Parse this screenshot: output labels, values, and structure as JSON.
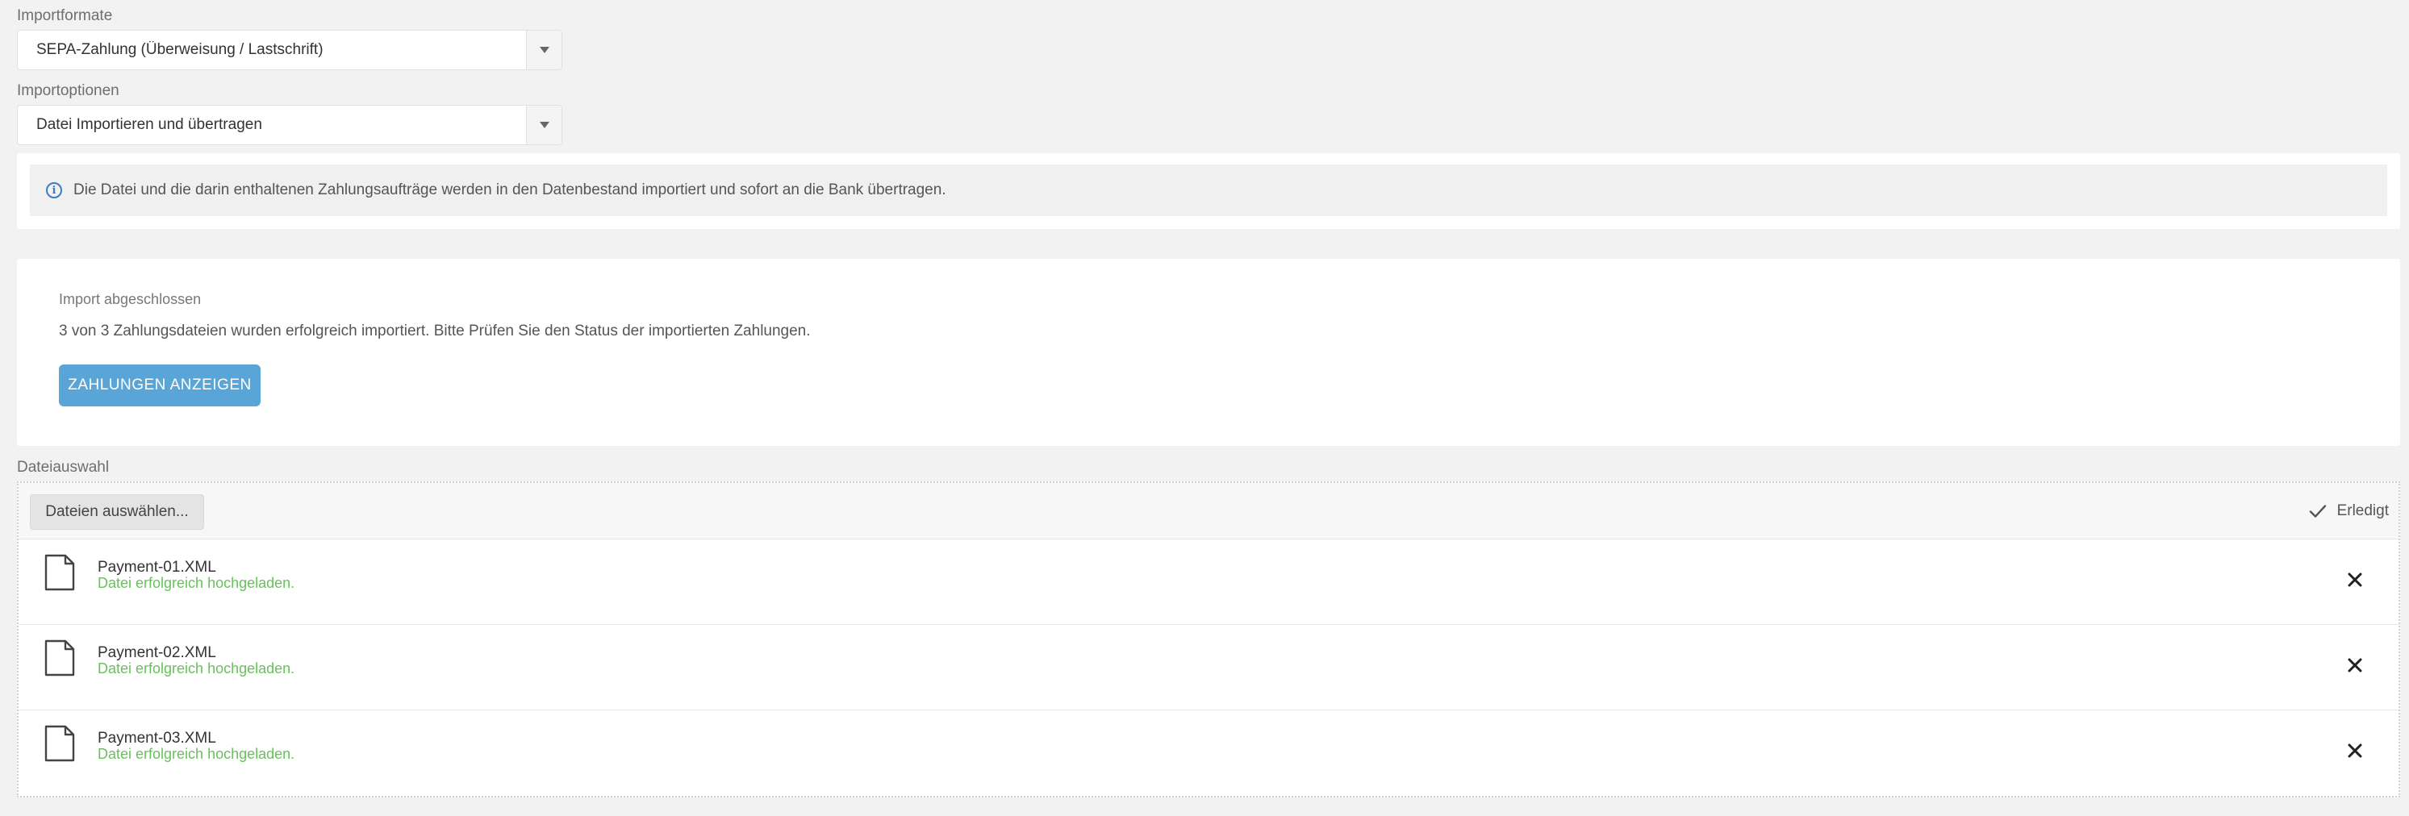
{
  "import_format": {
    "label": "Importformate",
    "selected": "SEPA-Zahlung (Überweisung / Lastschrift)"
  },
  "import_options": {
    "label": "Importoptionen",
    "selected": "Datei Importieren und übertragen"
  },
  "info": {
    "icon": "info-circle-icon",
    "text": "Die Datei und die darin enthaltenen Zahlungsaufträge werden in den Datenbestand importiert und sofort an die Bank übertragen."
  },
  "result": {
    "title": "Import abgeschlossen",
    "message": "3 von 3 Zahlungsdateien wurden erfolgreich importiert. Bitte Prüfen Sie den Status der importierten Zahlungen.",
    "button_label": "ZAHLUNGEN ANZEIGEN"
  },
  "upload": {
    "label": "Dateiauswahl",
    "select_button": "Dateien auswählen...",
    "done_label": "Erledigt",
    "files": [
      {
        "name": "Payment-01.XML",
        "status": "Datei erfolgreich hochgeladen."
      },
      {
        "name": "Payment-02.XML",
        "status": "Datei erfolgreich hochgeladen."
      },
      {
        "name": "Payment-03.XML",
        "status": "Datei erfolgreich hochgeladen."
      }
    ]
  },
  "colors": {
    "accent": "#5aa5d8",
    "success": "#6abf5e",
    "info": "#3b7cc4"
  }
}
